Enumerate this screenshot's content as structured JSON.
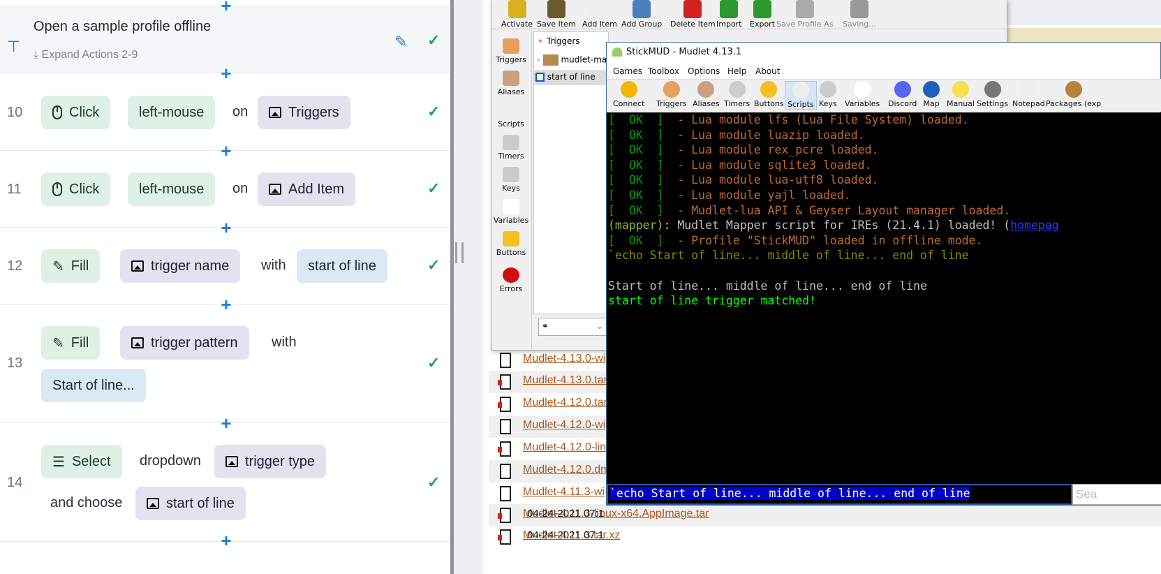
{
  "steps_panel": {
    "group": {
      "title": "Open a sample profile offline",
      "expand_label": "Expand Actions 2-9"
    },
    "steps": [
      {
        "num": "10",
        "action": "Click",
        "arg": "left-mouse",
        "joiner": "on",
        "target": "Triggers"
      },
      {
        "num": "11",
        "action": "Click",
        "arg": "left-mouse",
        "joiner": "on",
        "target": "Add Item"
      },
      {
        "num": "12",
        "action": "Fill",
        "target": "trigger name",
        "joiner": "with",
        "value": "start of line"
      },
      {
        "num": "13",
        "action": "Fill",
        "target": "trigger pattern",
        "joiner": "with",
        "value": "Start of line..."
      },
      {
        "num": "14",
        "action": "Select",
        "kind": "dropdown",
        "target": "trigger type",
        "joiner": "and choose",
        "value": "start of line"
      }
    ],
    "check": "✓",
    "plus": "+"
  },
  "editor": {
    "toolbar": [
      "Activate",
      "Save Item",
      "Add Item",
      "Add Group",
      "Delete Item",
      "Import",
      "Export",
      "Save Profile As",
      "Saving..."
    ],
    "sidebar": [
      "Triggers",
      "Aliases",
      "Scripts",
      "Timers",
      "Keys",
      "Variables",
      "Buttons",
      "Errors"
    ],
    "tree": {
      "root": "Triggers",
      "folder": "mudlet-ma",
      "item": "start of line"
    }
  },
  "mudlet": {
    "title": "StickMUD - Mudlet 4.13.1",
    "menu": [
      "Games",
      "Toolbox",
      "Options",
      "Help",
      "About"
    ],
    "toolbar": [
      "Connect",
      "Triggers",
      "Aliases",
      "Timers",
      "Buttons",
      "Scripts",
      "Keys",
      "Variables",
      "Discord",
      "Map",
      "Manual",
      "Settings",
      "Notepad",
      "Packages (exp"
    ],
    "selected_tool": "Scripts",
    "console": [
      {
        "ok": true,
        "text": "Lua module lfs (Lua File System) loaded."
      },
      {
        "ok": true,
        "text": "Lua module luazip loaded."
      },
      {
        "ok": true,
        "text": "Lua module rex_pcre loaded."
      },
      {
        "ok": true,
        "text": "Lua module sqlite3 loaded."
      },
      {
        "ok": true,
        "text": "Lua module lua-utf8 loaded."
      },
      {
        "ok": true,
        "text": "Lua module yajl loaded."
      },
      {
        "ok": true,
        "text": "Mudlet-lua API & Geyser Layout manager loaded."
      },
      {
        "mapper": true,
        "text": "Mudlet Mapper script for IREs (21.4.1) loaded! (",
        "link": "homepag"
      },
      {
        "ok": true,
        "text": "Profile \"StickMUD\" loaded in offline mode."
      },
      {
        "echo": true,
        "text": "`echo Start of line... middle of line... end of line"
      },
      {
        "plain": true,
        "text": ""
      },
      {
        "plain": true,
        "text": "Start of line... middle of line... end of line"
      },
      {
        "match": true,
        "text": "start of line trigger matched!"
      }
    ],
    "ok_tag": "OK",
    "command_input": "`echo Start of line... middle of line... end of line",
    "search_placeholder": "Sea"
  },
  "files": [
    {
      "name": "Mudlet-4.13.0-wi",
      "type": "bin"
    },
    {
      "name": "Mudlet-4.13.0.tar",
      "type": "arch"
    },
    {
      "name": "Mudlet-4.12.0.tar",
      "type": "arch"
    },
    {
      "name": "Mudlet-4.12.0-wi",
      "type": "bin"
    },
    {
      "name": "Mudlet-4.12.0-linu",
      "type": "arch"
    },
    {
      "name": "Mudlet-4.12.0.dm",
      "type": "disk"
    },
    {
      "name": "Mudlet-4.11.3-wi",
      "type": "bin"
    },
    {
      "name": "Mudlet-4.11.3-linux-x64.AppImage.tar",
      "type": "arch",
      "date": "04-24-2021 07:1"
    },
    {
      "name": "Mudlet-4.11.3.tar.xz",
      "type": "arch",
      "date": "04-24-2021 07:1"
    }
  ]
}
